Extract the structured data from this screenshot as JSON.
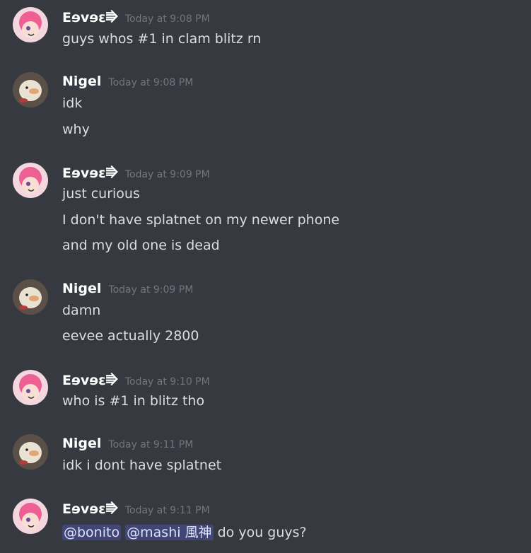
{
  "messages": [
    {
      "author": "Eɘvɘɛ⭆",
      "timestamp": "Today at 9:08 PM",
      "avatar": "eevee-avatar",
      "lines": [
        "guys whos #1 in clam blitz rn"
      ]
    },
    {
      "author": "Nigel",
      "timestamp": "Today at 9:08 PM",
      "avatar": "nigel-avatar",
      "lines": [
        "idk",
        "why"
      ]
    },
    {
      "author": "Eɘvɘɛ⭆",
      "timestamp": "Today at 9:09 PM",
      "avatar": "eevee-avatar",
      "lines": [
        "just curious",
        "I don't have splatnet on my newer phone",
        "and my old one is dead"
      ]
    },
    {
      "author": "Nigel",
      "timestamp": "Today at 9:09 PM",
      "avatar": "nigel-avatar",
      "lines": [
        "damn",
        "eevee actually 2800"
      ]
    },
    {
      "author": "Eɘvɘɛ⭆",
      "timestamp": "Today at 9:10 PM",
      "avatar": "eevee-avatar",
      "lines": [
        "who is #1 in blitz tho"
      ]
    },
    {
      "author": "Nigel",
      "timestamp": "Today at 9:11 PM",
      "avatar": "nigel-avatar",
      "lines": [
        "idk i dont have splatnet"
      ]
    },
    {
      "author": "Eɘvɘɛ⭆",
      "timestamp": "Today at 9:11 PM",
      "avatar": "eevee-avatar",
      "mentions": [
        "@bonito",
        "@mashi 風神"
      ],
      "tail": " do you guys?"
    }
  ],
  "colors": {
    "background": "#36393f",
    "username": "#ffffff",
    "timestamp": "#72767d",
    "text": "#dcddde",
    "mention_bg": "#414675",
    "mention_text": "#dee0fc"
  }
}
